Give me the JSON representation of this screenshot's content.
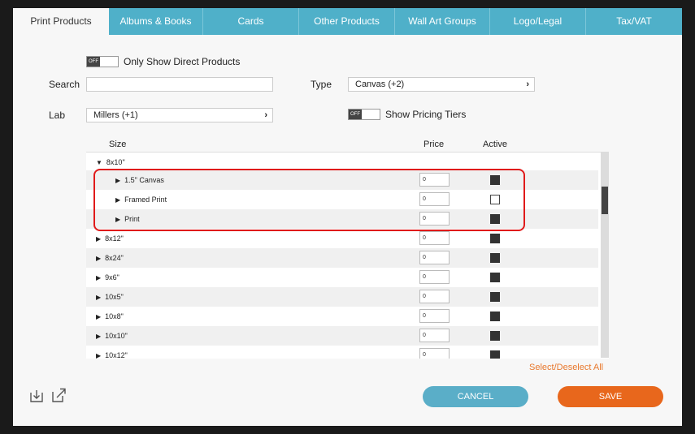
{
  "tabs": [
    {
      "label": "Print Products",
      "active": true
    },
    {
      "label": "Albums & Books"
    },
    {
      "label": "Cards"
    },
    {
      "label": "Other Products"
    },
    {
      "label": "Wall Art Groups"
    },
    {
      "label": "Logo/Legal"
    },
    {
      "label": "Tax/VAT"
    }
  ],
  "filters": {
    "direct_toggle_state": "OFF",
    "direct_label": "Only Show Direct Products",
    "search_label": "Search",
    "search_value": "",
    "type_label": "Type",
    "type_value": "Canvas (+2)",
    "lab_label": "Lab",
    "lab_value": "Millers (+1)",
    "tiers_toggle_state": "OFF",
    "tiers_label": "Show Pricing Tiers"
  },
  "table": {
    "headers": {
      "size": "Size",
      "price": "Price",
      "active": "Active"
    },
    "rows": [
      {
        "label": "8x10\"",
        "expanded": true,
        "level": 0
      },
      {
        "label": "1.5\" Canvas",
        "level": 1,
        "price": "0",
        "active": true
      },
      {
        "label": "Framed Print",
        "level": 1,
        "price": "0",
        "active": false
      },
      {
        "label": "Print",
        "level": 1,
        "price": "0",
        "active": true
      },
      {
        "label": "8x12\"",
        "level": 0,
        "price": "0",
        "active": true
      },
      {
        "label": "8x24\"",
        "level": 0,
        "price": "0",
        "active": true
      },
      {
        "label": "9x6\"",
        "level": 0,
        "price": "0",
        "active": true
      },
      {
        "label": "10x5\"",
        "level": 0,
        "price": "0",
        "active": true
      },
      {
        "label": "10x8\"",
        "level": 0,
        "price": "0",
        "active": true
      },
      {
        "label": "10x10\"",
        "level": 0,
        "price": "0",
        "active": true
      },
      {
        "label": "10x12\"",
        "level": 0,
        "price": "0",
        "active": true
      }
    ]
  },
  "select_all": "Select/Deselect All",
  "buttons": {
    "cancel": "CANCEL",
    "save": "SAVE"
  },
  "icons": {
    "import": "import-icon",
    "export": "external-link-icon"
  },
  "colors": {
    "accent": "#4fb0c9",
    "save": "#e8671c",
    "highlight": "#e01a1a"
  }
}
